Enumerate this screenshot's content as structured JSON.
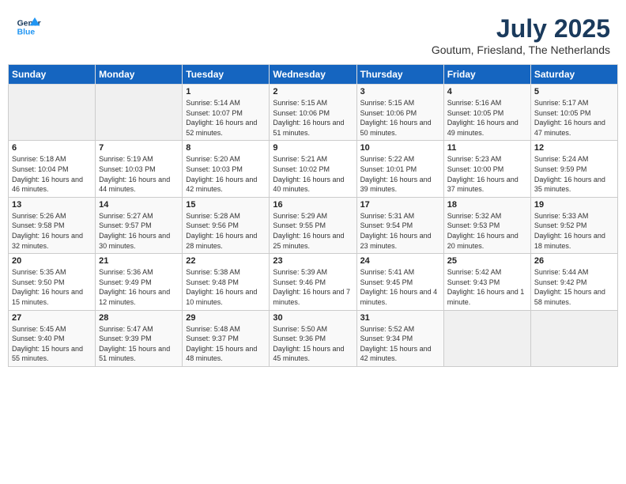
{
  "header": {
    "logo_line1": "General",
    "logo_line2": "Blue",
    "month": "July 2025",
    "location": "Goutum, Friesland, The Netherlands"
  },
  "days_of_week": [
    "Sunday",
    "Monday",
    "Tuesday",
    "Wednesday",
    "Thursday",
    "Friday",
    "Saturday"
  ],
  "weeks": [
    [
      {
        "day": "",
        "info": ""
      },
      {
        "day": "",
        "info": ""
      },
      {
        "day": "1",
        "info": "Sunrise: 5:14 AM\nSunset: 10:07 PM\nDaylight: 16 hours and 52 minutes."
      },
      {
        "day": "2",
        "info": "Sunrise: 5:15 AM\nSunset: 10:06 PM\nDaylight: 16 hours and 51 minutes."
      },
      {
        "day": "3",
        "info": "Sunrise: 5:15 AM\nSunset: 10:06 PM\nDaylight: 16 hours and 50 minutes."
      },
      {
        "day": "4",
        "info": "Sunrise: 5:16 AM\nSunset: 10:05 PM\nDaylight: 16 hours and 49 minutes."
      },
      {
        "day": "5",
        "info": "Sunrise: 5:17 AM\nSunset: 10:05 PM\nDaylight: 16 hours and 47 minutes."
      }
    ],
    [
      {
        "day": "6",
        "info": "Sunrise: 5:18 AM\nSunset: 10:04 PM\nDaylight: 16 hours and 46 minutes."
      },
      {
        "day": "7",
        "info": "Sunrise: 5:19 AM\nSunset: 10:03 PM\nDaylight: 16 hours and 44 minutes."
      },
      {
        "day": "8",
        "info": "Sunrise: 5:20 AM\nSunset: 10:03 PM\nDaylight: 16 hours and 42 minutes."
      },
      {
        "day": "9",
        "info": "Sunrise: 5:21 AM\nSunset: 10:02 PM\nDaylight: 16 hours and 40 minutes."
      },
      {
        "day": "10",
        "info": "Sunrise: 5:22 AM\nSunset: 10:01 PM\nDaylight: 16 hours and 39 minutes."
      },
      {
        "day": "11",
        "info": "Sunrise: 5:23 AM\nSunset: 10:00 PM\nDaylight: 16 hours and 37 minutes."
      },
      {
        "day": "12",
        "info": "Sunrise: 5:24 AM\nSunset: 9:59 PM\nDaylight: 16 hours and 35 minutes."
      }
    ],
    [
      {
        "day": "13",
        "info": "Sunrise: 5:26 AM\nSunset: 9:58 PM\nDaylight: 16 hours and 32 minutes."
      },
      {
        "day": "14",
        "info": "Sunrise: 5:27 AM\nSunset: 9:57 PM\nDaylight: 16 hours and 30 minutes."
      },
      {
        "day": "15",
        "info": "Sunrise: 5:28 AM\nSunset: 9:56 PM\nDaylight: 16 hours and 28 minutes."
      },
      {
        "day": "16",
        "info": "Sunrise: 5:29 AM\nSunset: 9:55 PM\nDaylight: 16 hours and 25 minutes."
      },
      {
        "day": "17",
        "info": "Sunrise: 5:31 AM\nSunset: 9:54 PM\nDaylight: 16 hours and 23 minutes."
      },
      {
        "day": "18",
        "info": "Sunrise: 5:32 AM\nSunset: 9:53 PM\nDaylight: 16 hours and 20 minutes."
      },
      {
        "day": "19",
        "info": "Sunrise: 5:33 AM\nSunset: 9:52 PM\nDaylight: 16 hours and 18 minutes."
      }
    ],
    [
      {
        "day": "20",
        "info": "Sunrise: 5:35 AM\nSunset: 9:50 PM\nDaylight: 16 hours and 15 minutes."
      },
      {
        "day": "21",
        "info": "Sunrise: 5:36 AM\nSunset: 9:49 PM\nDaylight: 16 hours and 12 minutes."
      },
      {
        "day": "22",
        "info": "Sunrise: 5:38 AM\nSunset: 9:48 PM\nDaylight: 16 hours and 10 minutes."
      },
      {
        "day": "23",
        "info": "Sunrise: 5:39 AM\nSunset: 9:46 PM\nDaylight: 16 hours and 7 minutes."
      },
      {
        "day": "24",
        "info": "Sunrise: 5:41 AM\nSunset: 9:45 PM\nDaylight: 16 hours and 4 minutes."
      },
      {
        "day": "25",
        "info": "Sunrise: 5:42 AM\nSunset: 9:43 PM\nDaylight: 16 hours and 1 minute."
      },
      {
        "day": "26",
        "info": "Sunrise: 5:44 AM\nSunset: 9:42 PM\nDaylight: 15 hours and 58 minutes."
      }
    ],
    [
      {
        "day": "27",
        "info": "Sunrise: 5:45 AM\nSunset: 9:40 PM\nDaylight: 15 hours and 55 minutes."
      },
      {
        "day": "28",
        "info": "Sunrise: 5:47 AM\nSunset: 9:39 PM\nDaylight: 15 hours and 51 minutes."
      },
      {
        "day": "29",
        "info": "Sunrise: 5:48 AM\nSunset: 9:37 PM\nDaylight: 15 hours and 48 minutes."
      },
      {
        "day": "30",
        "info": "Sunrise: 5:50 AM\nSunset: 9:36 PM\nDaylight: 15 hours and 45 minutes."
      },
      {
        "day": "31",
        "info": "Sunrise: 5:52 AM\nSunset: 9:34 PM\nDaylight: 15 hours and 42 minutes."
      },
      {
        "day": "",
        "info": ""
      },
      {
        "day": "",
        "info": ""
      }
    ]
  ]
}
